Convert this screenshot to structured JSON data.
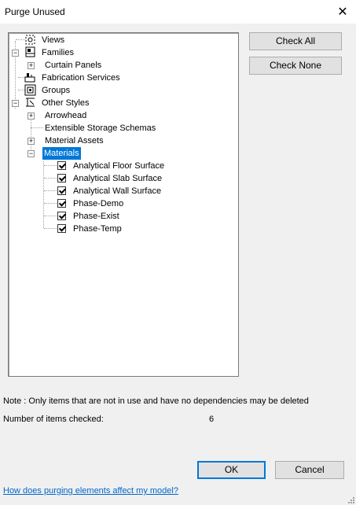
{
  "window": {
    "title": "Purge Unused",
    "close_icon": "close-icon"
  },
  "tree": {
    "items": [
      {
        "label": "Views",
        "level": 0,
        "icon": "views-icon",
        "expander": ""
      },
      {
        "label": "Families",
        "level": 0,
        "icon": "families-icon",
        "expander": "minus"
      },
      {
        "label": "Curtain Panels",
        "level": 1,
        "icon": "",
        "expander": "plus"
      },
      {
        "label": "Fabrication Services",
        "level": 0,
        "icon": "fabrication-icon",
        "expander": ""
      },
      {
        "label": "Groups",
        "level": 0,
        "icon": "groups-icon",
        "expander": ""
      },
      {
        "label": "Other Styles",
        "level": 0,
        "icon": "other-styles-icon",
        "expander": "minus"
      },
      {
        "label": "Arrowhead",
        "level": 1,
        "icon": "",
        "expander": "plus"
      },
      {
        "label": "Extensible Storage Schemas",
        "level": 1,
        "icon": "",
        "expander": ""
      },
      {
        "label": "Material Assets",
        "level": 1,
        "icon": "",
        "expander": "plus"
      },
      {
        "label": "Materials",
        "level": 1,
        "icon": "",
        "expander": "minus",
        "selected": true
      },
      {
        "label": "Analytical Floor Surface",
        "level": 2,
        "checked": true
      },
      {
        "label": "Analytical Slab Surface",
        "level": 2,
        "checked": true
      },
      {
        "label": "Analytical Wall Surface",
        "level": 2,
        "checked": true
      },
      {
        "label": "Phase-Demo",
        "level": 2,
        "checked": true
      },
      {
        "label": "Phase-Exist",
        "level": 2,
        "checked": true
      },
      {
        "label": "Phase-Temp",
        "level": 2,
        "checked": true
      }
    ]
  },
  "buttons": {
    "check_all": "Check All",
    "check_none": "Check None",
    "ok": "OK",
    "cancel": "Cancel"
  },
  "footer": {
    "note": "Note : Only items that are not in use and have no dependencies may be deleted",
    "count_label": "Number of items checked:",
    "count_value": "6",
    "help_link": "How does purging elements affect my model?"
  },
  "colors": {
    "selection": "#0078d7",
    "link": "#0066cc"
  }
}
